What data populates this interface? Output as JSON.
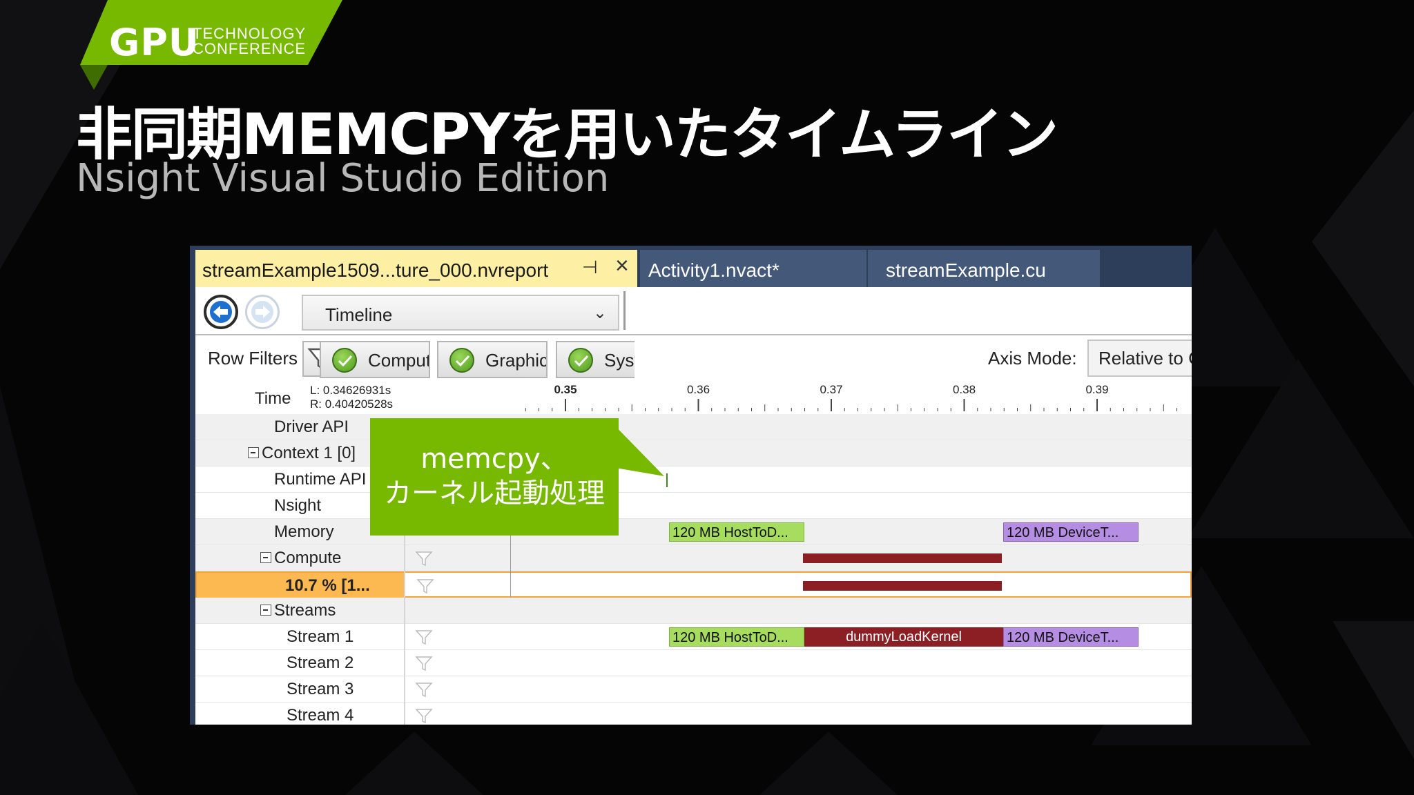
{
  "badge": {
    "gpu": "GPU",
    "line1": "TECHNOLOGY",
    "line2": "CONFERENCE",
    "color": "#76b900"
  },
  "slide": {
    "title": "非同期MEMCPYを用いたタイムライン",
    "subtitle": "Nsight Visual Studio Edition"
  },
  "tabs": {
    "active": "streamExample1509...ture_000.nvreport",
    "pin_icon": "pin-icon",
    "close_icon": "close-icon",
    "activity": "Activity1.nvact*",
    "source": "streamExample.cu"
  },
  "toolbar": {
    "view": "Timeline"
  },
  "filters": {
    "row_filters_label": "Row Filters",
    "compute": "Compute",
    "graphics": "Graphics",
    "system": "System",
    "axis_mode_label": "Axis Mode:",
    "axis_mode_value": "Relative to Capture"
  },
  "time": {
    "label": "Time",
    "left": "L: 0.34626931s",
    "right": "R: 0.40420528s",
    "ticks": [
      "0.35",
      "0.36",
      "0.37",
      "0.38",
      "0.39"
    ]
  },
  "rows": {
    "driver_api": "Driver API",
    "context": "Context 1 [0]",
    "runtime": "Runtime API",
    "nsight": "Nsight",
    "memory": "Memory",
    "compute": "Compute",
    "kernel_pct": "10.7 % [1...",
    "streams": "Streams",
    "stream1": "Stream 1",
    "stream2": "Stream 2",
    "stream3": "Stream 3",
    "stream4": "Stream 4"
  },
  "bars": {
    "htod": "120 MB HostToD...",
    "dtoh": "120 MB DeviceT...",
    "kernel": "dummyLoadKernel"
  },
  "callout": {
    "line1": "memcpy、",
    "line2": "カーネル起動処理"
  },
  "colors": {
    "accent": "#76b900",
    "tab_active": "#fdf0a4",
    "selected_row": "#fcb951",
    "memcpy_htod": "#a7dd5e",
    "memcpy_dtoh": "#b58ee4",
    "kernel": "#8b1f24"
  }
}
